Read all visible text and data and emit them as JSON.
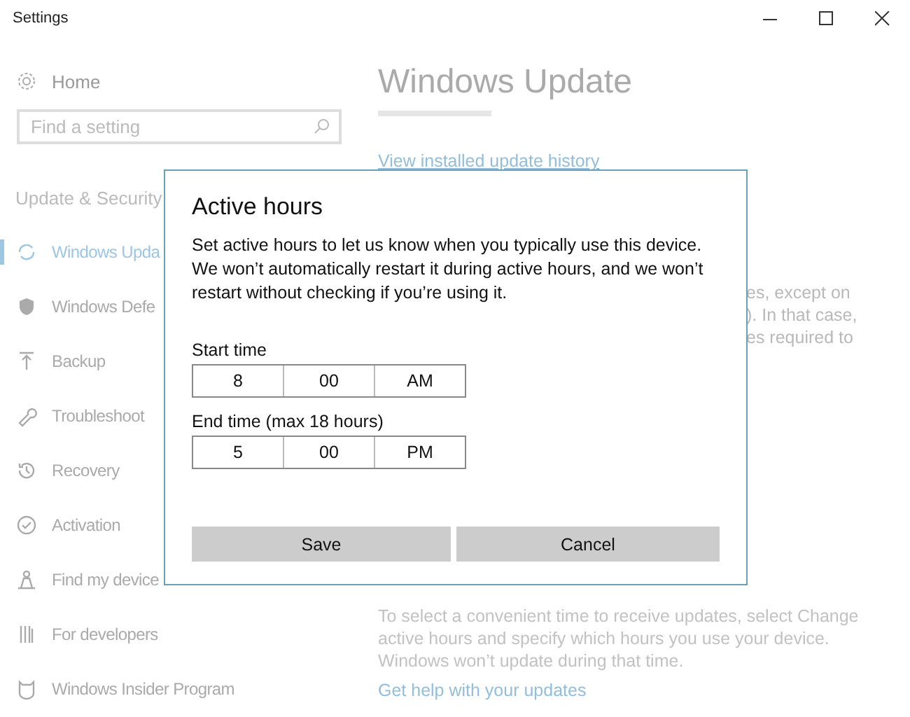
{
  "window": {
    "title": "Settings"
  },
  "sidebar": {
    "home": "Home",
    "search": {
      "placeholder": "Find a setting"
    },
    "section": "Update & Security",
    "items": [
      {
        "label": "Windows Upda",
        "selected": true
      },
      {
        "label": "Windows Defe",
        "selected": false
      },
      {
        "label": "Backup",
        "selected": false
      },
      {
        "label": "Troubleshoot",
        "selected": false
      },
      {
        "label": "Recovery",
        "selected": false
      },
      {
        "label": "Activation",
        "selected": false
      },
      {
        "label": "Find my device",
        "selected": false
      },
      {
        "label": "For developers",
        "selected": false
      },
      {
        "label": "Windows Insider Program",
        "selected": false
      }
    ]
  },
  "main": {
    "title": "Windows Update",
    "history_link": "View installed update history",
    "fragments": [
      "es, except on",
      "). In that case,",
      "es required to"
    ],
    "active_hours_text": "To select a convenient time to receive updates, select Change active hours and specify which hours you use your device. Windows won’t update during that time.",
    "help_link": "Get help with your updates"
  },
  "dialog": {
    "title": "Active hours",
    "text": "Set active hours to let us know when you typically use this device. We won’t automatically restart it during active hours, and we won’t restart without checking if you’re using it.",
    "times": [
      {
        "label": "Start time",
        "hour": "8",
        "minute": "00",
        "period": "AM"
      },
      {
        "label": "End time (max 18 hours)",
        "hour": "5",
        "minute": "00",
        "period": "PM"
      }
    ],
    "buttons": [
      "Save",
      "Cancel"
    ]
  }
}
